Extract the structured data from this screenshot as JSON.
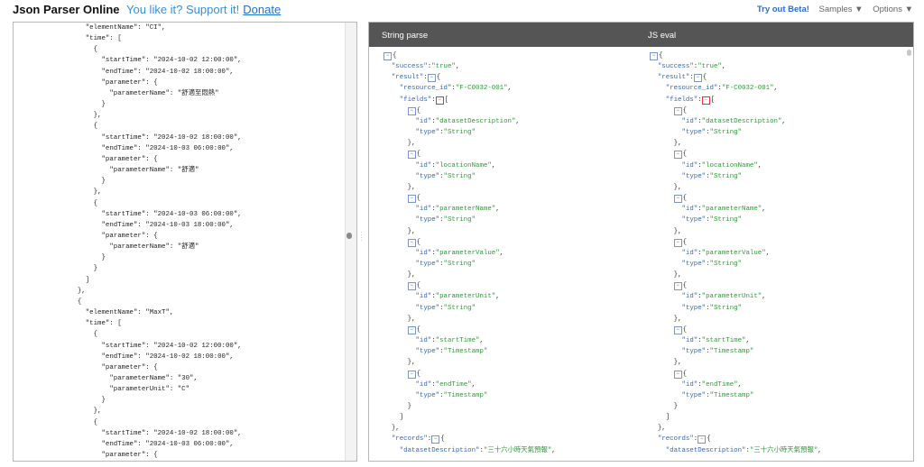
{
  "header": {
    "title": "Json Parser Online",
    "promo_text": "You like it? Support it!",
    "donate_label": "Donate",
    "try_beta_label": "Try out Beta!",
    "samples_label": "Samples ▼",
    "options_label": "Options ▼"
  },
  "editor": {
    "lines": [
      "    \"elementName\": \"CI\",",
      "    \"time\": [",
      "      {",
      "        \"startTime\": \"2024-10-02 12:00:00\",",
      "        \"endTime\": \"2024-10-02 18:00:00\",",
      "        \"parameter\": {",
      "          \"parameterName\": \"舒適至悶熱\"",
      "        }",
      "      },",
      "      {",
      "        \"startTime\": \"2024-10-02 18:00:00\",",
      "        \"endTime\": \"2024-10-03 06:00:00\",",
      "        \"parameter\": {",
      "          \"parameterName\": \"舒適\"",
      "        }",
      "      },",
      "      {",
      "        \"startTime\": \"2024-10-03 06:00:00\",",
      "        \"endTime\": \"2024-10-03 18:00:00\",",
      "        \"parameter\": {",
      "          \"parameterName\": \"舒適\"",
      "        }",
      "      }",
      "    ]",
      "  },",
      "  {",
      "    \"elementName\": \"MaxT\",",
      "    \"time\": [",
      "      {",
      "        \"startTime\": \"2024-10-02 12:00:00\",",
      "        \"endTime\": \"2024-10-02 18:00:00\",",
      "        \"parameter\": {",
      "          \"parameterName\": \"30\",",
      "          \"parameterUnit\": \"C\"",
      "        }",
      "      },",
      "      {",
      "        \"startTime\": \"2024-10-02 18:00:00\",",
      "        \"endTime\": \"2024-10-03 06:00:00\",",
      "        \"parameter\": {"
    ]
  },
  "viewer": {
    "string_parse_label": "String parse",
    "js_eval_label": "JS eval",
    "fields": [
      {
        "id": "\"datasetDescription\"",
        "type": "\"String\""
      },
      {
        "id": "\"locationName\"",
        "type": "\"String\""
      },
      {
        "id": "\"parameterName\"",
        "type": "\"String\""
      },
      {
        "id": "\"parameterValue\"",
        "type": "\"String\""
      },
      {
        "id": "\"parameterUnit\"",
        "type": "\"String\""
      },
      {
        "id": "\"startTime\"",
        "type": "\"Timestamp\""
      },
      {
        "id": "\"endTime\"",
        "type": "\"Timestamp\""
      }
    ],
    "success_value": "\"true\"",
    "resource_id_value": "\"F-C0032-001\"",
    "dataset_description_value": "\"三十六小時天氣預報\""
  },
  "colors": {
    "key": "#3a66b4",
    "string": "#2f9a3a",
    "header_bg": "#555555",
    "link": "#1e73c9"
  }
}
